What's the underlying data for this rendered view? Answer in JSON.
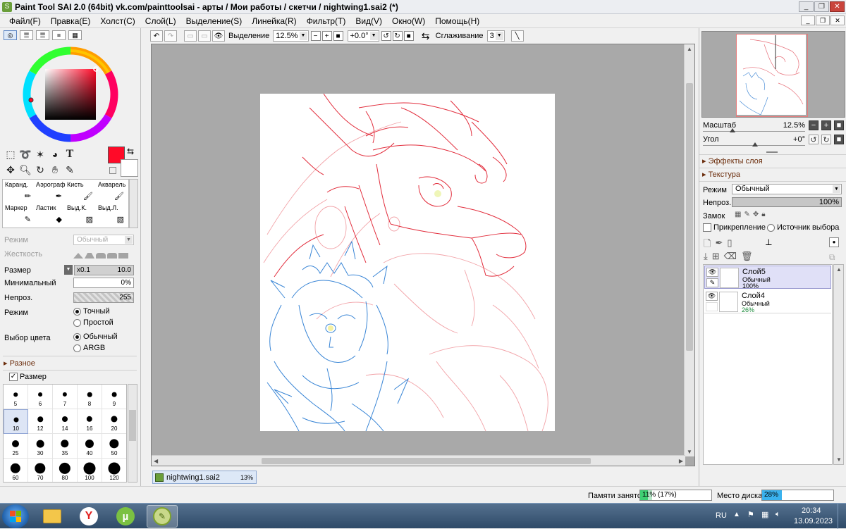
{
  "window": {
    "title": "Paint Tool SAI 2.0 (64bit) vk.com/painttoolsai - арты / Мои работы / скетчи / nightwing1.sai2 (*)"
  },
  "menu": [
    "Файл(F)",
    "Правка(E)",
    "Холст(C)",
    "Слой(L)",
    "Выделение(S)",
    "Линейка(R)",
    "Фильтр(T)",
    "Вид(V)",
    "Окно(W)",
    "Помощь(H)"
  ],
  "canvas_toolbar": {
    "selection_label": "Выделение",
    "zoom": "12.5%",
    "angle": "+0.0°",
    "smoothing_label": "Сглаживание",
    "smoothing_value": "3"
  },
  "color": {
    "foreground": "#ff0a28",
    "background": "#ffffff"
  },
  "brushes": [
    {
      "label": "Каранд.",
      "icon": "pencil-icon"
    },
    {
      "label": "Аэрограф",
      "icon": "airbrush-icon"
    },
    {
      "label": "Кисть",
      "icon": "brush-icon"
    },
    {
      "label": "Акварель",
      "icon": "watercolor-icon"
    },
    {
      "label": "Маркер",
      "icon": "marker-icon"
    },
    {
      "label": "Ластик",
      "icon": "eraser-icon"
    },
    {
      "label": "Выд.К.",
      "icon": "select-pen-icon"
    },
    {
      "label": "Выд.Л.",
      "icon": "select-eraser-icon"
    }
  ],
  "tool_props": {
    "mode_label": "Режим",
    "mode_value": "Обычный",
    "hardness_label": "Жесткость",
    "size_label": "Размер",
    "size_mult": "x0.1",
    "size_value": "10.0",
    "min_label": "Минимальный",
    "min_value": "0%",
    "min_fraction": 0,
    "opacity_label": "Непроз.",
    "opacity_value": "255",
    "opacity_fraction": 1,
    "blend_label": "Режим",
    "blend_opt1": "Точный",
    "blend_opt2": "Простой",
    "colorsel_label": "Выбор цвета",
    "colorsel_opt1": "Обычный",
    "colorsel_opt2": "ARGB",
    "misc_section": "Разное",
    "size_check": "Размер"
  },
  "brush_sizes": [
    "5",
    "6",
    "7",
    "8",
    "9",
    "10",
    "12",
    "14",
    "16",
    "20",
    "25",
    "30",
    "35",
    "40",
    "50",
    "60",
    "70",
    "80",
    "100",
    "120"
  ],
  "selected_size": "10",
  "navigator": {
    "zoom_label": "Масштаб",
    "zoom_value": "12.5%",
    "angle_label": "Угол",
    "angle_value": "+0°"
  },
  "layer_panel": {
    "effects": "Эффекты слоя",
    "texture": "Текстура",
    "mode_label": "Режим",
    "mode_value": "Обычный",
    "opacity_label": "Непроз.",
    "opacity_value": "100%",
    "opacity_fraction": 1,
    "lock_label": "Замок",
    "clip_label": "Прикрепление",
    "source_label": "Источник выбора"
  },
  "layers": [
    {
      "name": "Слой5",
      "mode": "Обычный",
      "opacity": "100%",
      "selected": true
    },
    {
      "name": "Слой4",
      "mode": "Обычный",
      "opacity": "26%",
      "selected": false
    }
  ],
  "file_tab": {
    "name": "nightwing1.sai2",
    "zoom": "13%"
  },
  "status": {
    "memory_label": "Памяти занято",
    "memory_value": "11% (17%)",
    "memory_fraction": 0.11,
    "memory_fraction2": 0.17,
    "disk_label": "Место диска",
    "disk_value": "28%",
    "disk_fraction": 0.28
  },
  "taskbar": {
    "lang": "RU",
    "time": "20:34",
    "date": "13.09.2023"
  }
}
